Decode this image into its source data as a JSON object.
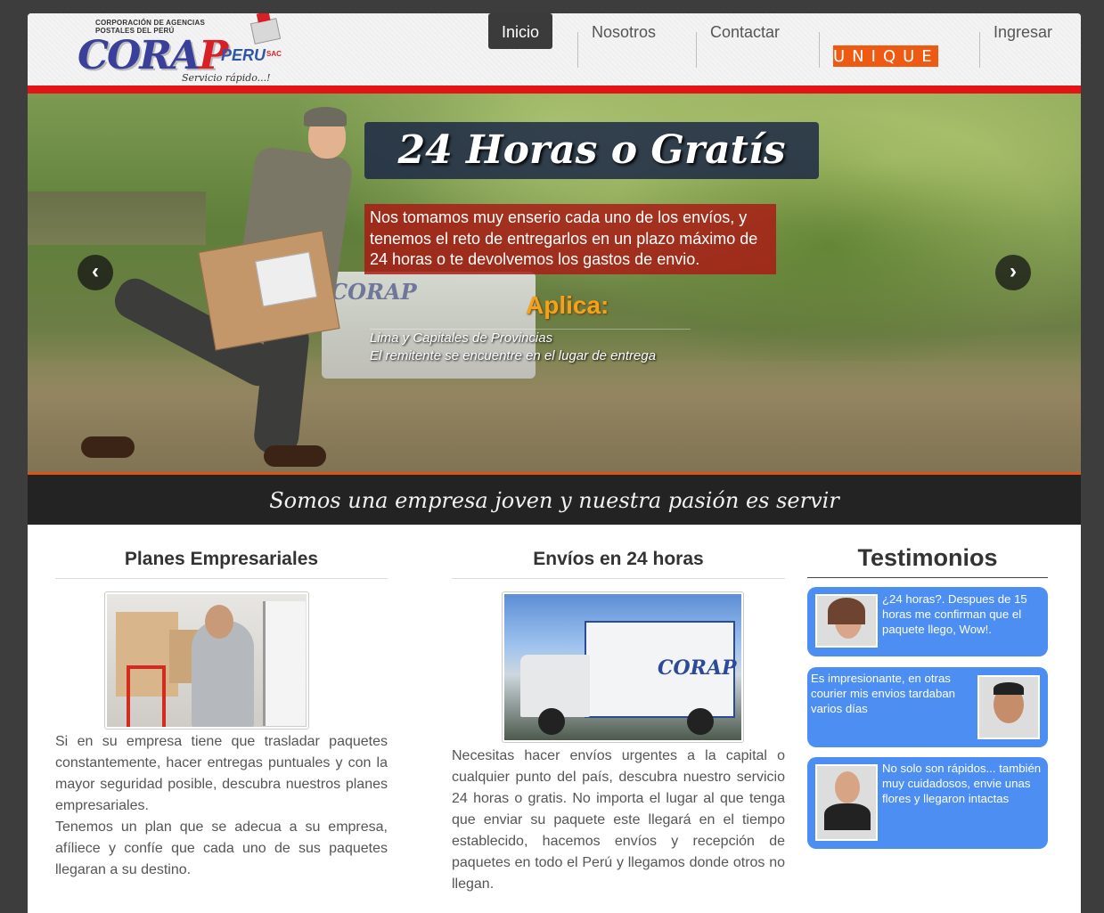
{
  "header": {
    "logo": {
      "corp_line1": "CORPORACIÓN DE AGENCIAS",
      "corp_line2": "POSTALES DEL PERÚ",
      "brand_cor": "CORA",
      "brand_p": "P",
      "brand_peru": "PERU",
      "brand_sac": "SAC",
      "slogan": "Servicio rápido...!"
    },
    "nav": {
      "home": "Inicio",
      "about": "Nosotros",
      "contact": "Contactar",
      "unique": "UNIQUE",
      "login": "Ingresar"
    }
  },
  "hero": {
    "title": "24 Horas o Gratís",
    "description": "Nos tomamos muy enserio cada uno de los envíos, y tenemos el reto de entregarlos en un plazo máximo de 24 horas o te devolvemos los gastos de envio.",
    "apply_label": "Aplica:",
    "conditions": [
      "Lima y Capitales de Provincias",
      "El remitente se encuentre en el lugar de entrega"
    ],
    "truck_text": "CORAP",
    "prev_arrow": "‹",
    "next_arrow": "›"
  },
  "motto": "Somos una empresa joven y nuestra pasión es servir",
  "columns": {
    "plans": {
      "title": "Planes Empresariales",
      "text": "Si en su empresa tiene que trasladar paquetes constantemente, hacer entregas puntuales y con la mayor seguridad posible, descubra nuestros planes empresariales.",
      "text2": "Tenemos un plan que se adecua a su empresa, afíliece y confíe que cada uno de sus paquetes llegaran a su destino."
    },
    "shipping": {
      "title": "Envíos en 24 horas",
      "truck_text": "CORAP",
      "text": "Necesitas hacer envíos urgentes a la capital o cualquier punto del país, descubra nuestro servicio 24 horas o gratis. No importa el lugar al que tenga que enviar su paquete este llegará en el tiempo establecido, hacemos envíos y recepción de paquetes en todo el Perú y llegamos donde otros no llegan."
    }
  },
  "testimonials": {
    "title": "Testimonios",
    "items": [
      {
        "text": "¿24 horas?. Despues de 15 horas me confirman que el paquete llego, Wow!."
      },
      {
        "text": "Es impresionante, en otras courier mis envios tardaban varios días"
      },
      {
        "text": "No solo son rápidos... también muy cuidadosos, envie unas flores y llegaron intactas"
      }
    ]
  },
  "colors": {
    "accent_red": "#e21414",
    "nav_active": "#3b3b3b",
    "unique_orange": "#ee5a12",
    "testimonial_blue": "#4d8ef2",
    "apply_orange": "#f3a21b"
  }
}
